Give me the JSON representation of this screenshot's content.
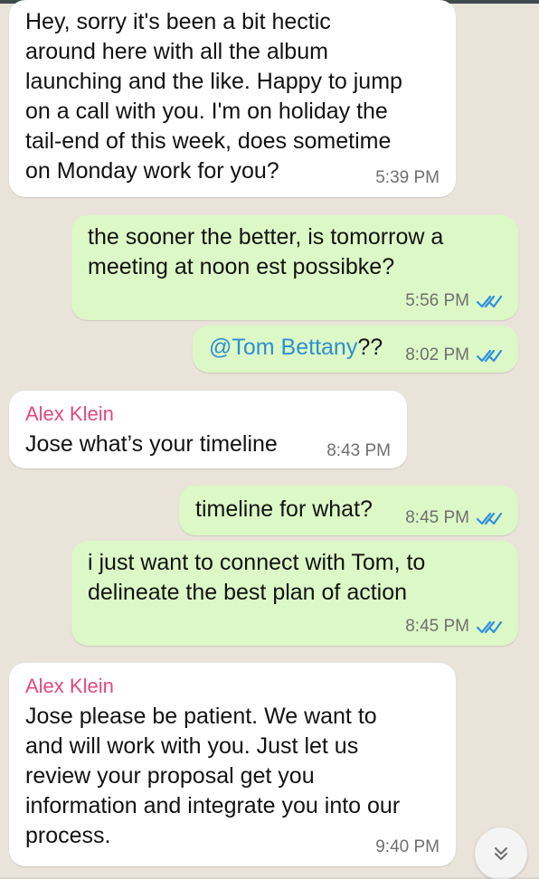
{
  "colors": {
    "background": "#e9e3da",
    "incoming_bubble": "#ffffff",
    "outgoing_bubble": "#dcf8c6",
    "sender_name": "#e5487c",
    "mention": "#2c8fd1",
    "read_ticks": "#2f8fe0",
    "timestamp": "#6f6f6f"
  },
  "messages": [
    {
      "text": "Hey, sorry it's been a bit hectic\naround here with all the album\nlaunching and the like. Happy to jump\non a call with you. I'm on holiday the\ntail-end of this week, does sometime\non Monday work for you?",
      "time": "5:39 PM"
    },
    {
      "text": "the sooner the better, is tomorrow a\nmeeting at noon est possibke?",
      "time": "5:56 PM",
      "status_icon": "double-check-icon"
    },
    {
      "mention": "@Tom Bettany",
      "suffix": "??",
      "time": "8:02 PM",
      "status_icon": "double-check-icon"
    },
    {
      "sender": "Alex Klein",
      "text": "Jose what’s your timeline",
      "time": "8:43 PM"
    },
    {
      "text": "timeline for what?",
      "time": "8:45 PM",
      "status_icon": "double-check-icon"
    },
    {
      "text": "i just want to connect with Tom, to\ndelineate the best plan of action",
      "time": "8:45 PM",
      "status_icon": "double-check-icon"
    },
    {
      "sender": "Alex Klein",
      "text": "Jose please be patient. We want to\nand will work with you. Just let us\nreview your proposal get you\ninformation and integrate you into our\nprocess.",
      "time": "9:40 PM"
    }
  ],
  "scroll_button": {
    "icon": "double-chevron-down-icon"
  }
}
